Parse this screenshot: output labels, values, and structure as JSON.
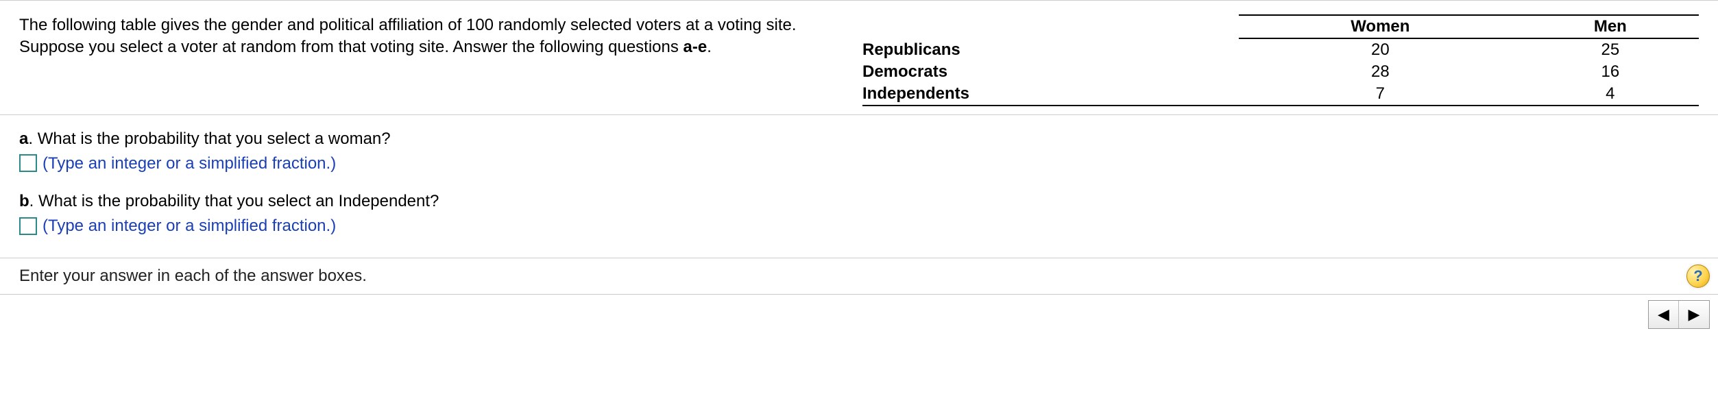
{
  "problem": {
    "intro_prefix": "The following table gives the gender and political affiliation of 100 randomly selected voters at a voting site. Suppose you select a voter at random from that voting site. Answer the following questions ",
    "intro_bold": "a-e",
    "intro_suffix": "."
  },
  "table": {
    "headers": {
      "col1": "Women",
      "col2": "Men"
    },
    "rows": [
      {
        "party": "Republicans",
        "women": "20",
        "men": "25"
      },
      {
        "party": "Democrats",
        "women": "28",
        "men": "16"
      },
      {
        "party": "Independents",
        "women": "7",
        "men": "4"
      }
    ]
  },
  "questions": {
    "a": {
      "label": "a",
      "text": ". What is the probability that you select a woman?",
      "hint": "(Type an integer or a simplified fraction.)"
    },
    "b": {
      "label": "b",
      "text": ". What is the probability that you select an Independent?",
      "hint": "(Type an integer or a simplified fraction.)"
    }
  },
  "footer": {
    "prompt": "Enter your answer in each of the answer boxes.",
    "help": "?"
  },
  "nav": {
    "prev": "◀",
    "next": "▶"
  }
}
